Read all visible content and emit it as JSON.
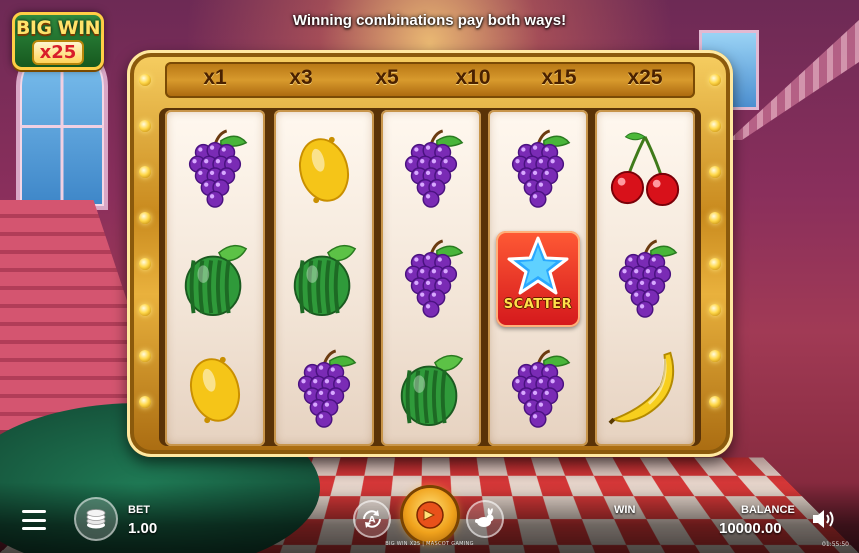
{
  "logo": {
    "title": "BIG WIN",
    "multiplier": "x25"
  },
  "message": "Winning combinations pay both ways!",
  "multipliers": [
    "x1",
    "x3",
    "x5",
    "x10",
    "x15",
    "x25"
  ],
  "reels": [
    [
      "grapes",
      "watermelon",
      "lemon"
    ],
    [
      "lemon",
      "watermelon",
      "grapes"
    ],
    [
      "grapes",
      "grapes",
      "watermelon"
    ],
    [
      "grapes",
      "scatter",
      "grapes"
    ],
    [
      "cherries",
      "grapes",
      "banana"
    ]
  ],
  "scatter_label": "SCATTER",
  "bet": {
    "label": "BET",
    "value": "1.00"
  },
  "win": {
    "label": "WIN",
    "value": ""
  },
  "balance": {
    "label": "BALANCE",
    "value": "10000.00"
  },
  "footer": "BIG WIN X25 | MASCOT GAMING",
  "clock": "01:55:50",
  "colors": {
    "frame_gold": "#e9b13d",
    "scatter_red": "#d4181c",
    "grape": "#7a2bb5",
    "watermelon": "#2f9a3a",
    "lemon": "#f5c518"
  }
}
